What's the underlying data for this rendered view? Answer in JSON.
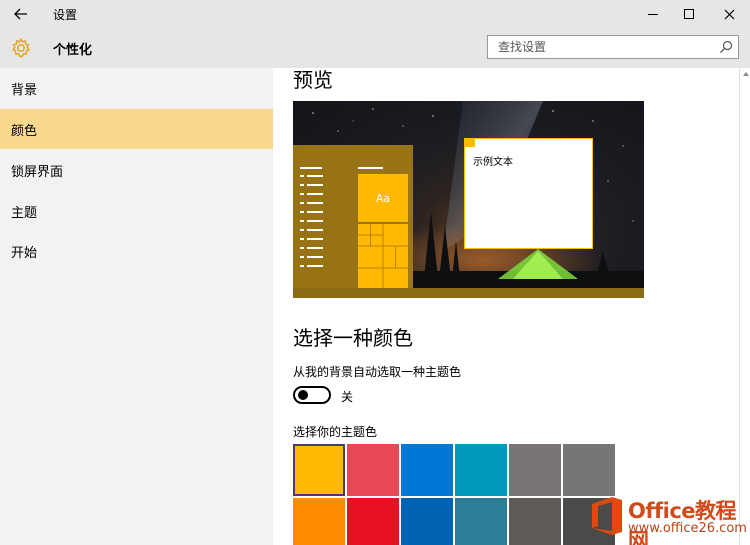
{
  "window": {
    "title": "设置",
    "back_icon": "back-arrow-icon",
    "minimize_icon": "minimize-icon",
    "maximize_icon": "maximize-icon",
    "close_icon": "close-icon"
  },
  "header": {
    "title": "个性化",
    "icon": "gear-icon",
    "search_placeholder": "查找设置",
    "search_icon": "search-icon"
  },
  "sidebar": {
    "items": [
      {
        "label": "背景",
        "active": false
      },
      {
        "label": "颜色",
        "active": true
      },
      {
        "label": "锁屏界面",
        "active": false
      },
      {
        "label": "主题",
        "active": false
      },
      {
        "label": "开始",
        "active": false
      }
    ]
  },
  "main": {
    "preview_heading": "预览",
    "preview": {
      "tile_text": "Aa",
      "sample_text": "示例文本"
    },
    "choose_heading": "选择一种颜色",
    "auto_label": "从我的背景自动选取一种主题色",
    "toggle_state_label": "关",
    "toggle_on": false,
    "accent_label": "选择你的主题色",
    "swatch_colors": [
      "#ffb900",
      "#e74856",
      "#0078d7",
      "#0099bc",
      "#7a7574",
      "#767676",
      "#ff8c00",
      "#e81123",
      "#0063b1",
      "#2d7d9a",
      "#5d5a58",
      "#4c4a48"
    ],
    "selected_swatch": 0
  },
  "colors": {
    "accent": "#ffb900",
    "sidebar_active": "#f8d98e"
  },
  "watermark": {
    "title": "Office教程网",
    "url": "www.office26.com"
  }
}
